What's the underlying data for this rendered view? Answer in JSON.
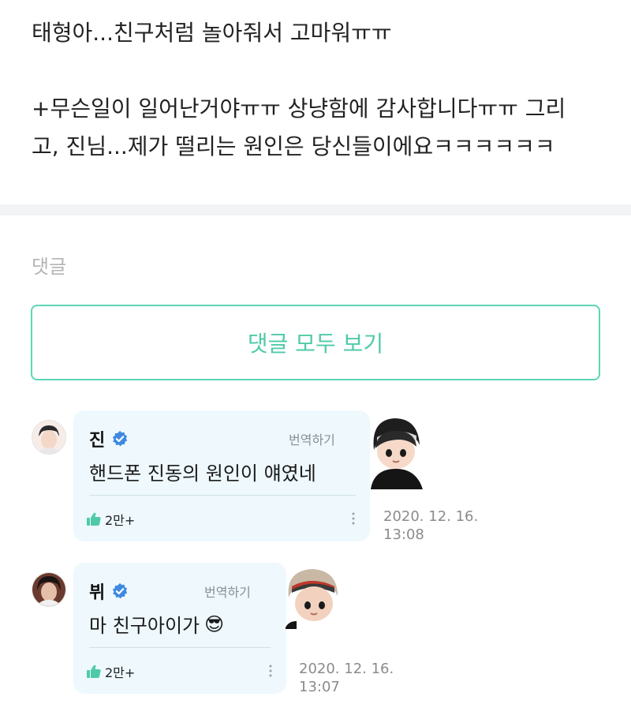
{
  "post": {
    "line1": "태형아...친구처럼 놀아줘서 고마워ㅠㅠ",
    "line2": "+무슨일이 일어난거야ㅠㅠ 상냥함에 감사합니다ㅠㅠ 그리",
    "line3": "고, 진님...제가 떨리는 원인은 당신들이에요ㅋㅋㅋㅋㅋㅋ"
  },
  "comments_section": {
    "title": "댓글",
    "view_all_label": "댓글 모두 보기"
  },
  "comments": [
    {
      "author": "진",
      "translate_label": "번역하기",
      "text": "핸드폰 진동의 원인이 얘였네",
      "likes": "2만+",
      "date": "2020. 12. 16.",
      "time": "13:08"
    },
    {
      "author": "뷔",
      "translate_label": "번역하기",
      "text": "마 친구아이가",
      "emoji": "😎",
      "likes": "2만+",
      "date": "2020. 12. 16.",
      "time": "13:07"
    }
  ],
  "icons": {
    "verified": "verified-badge-icon",
    "like": "thumbs-up-icon",
    "more": "vertical-dots-icon"
  },
  "colors": {
    "accent": "#4fcaa8",
    "bubble": "#eef8fd",
    "verified": "#3f8ae0"
  }
}
